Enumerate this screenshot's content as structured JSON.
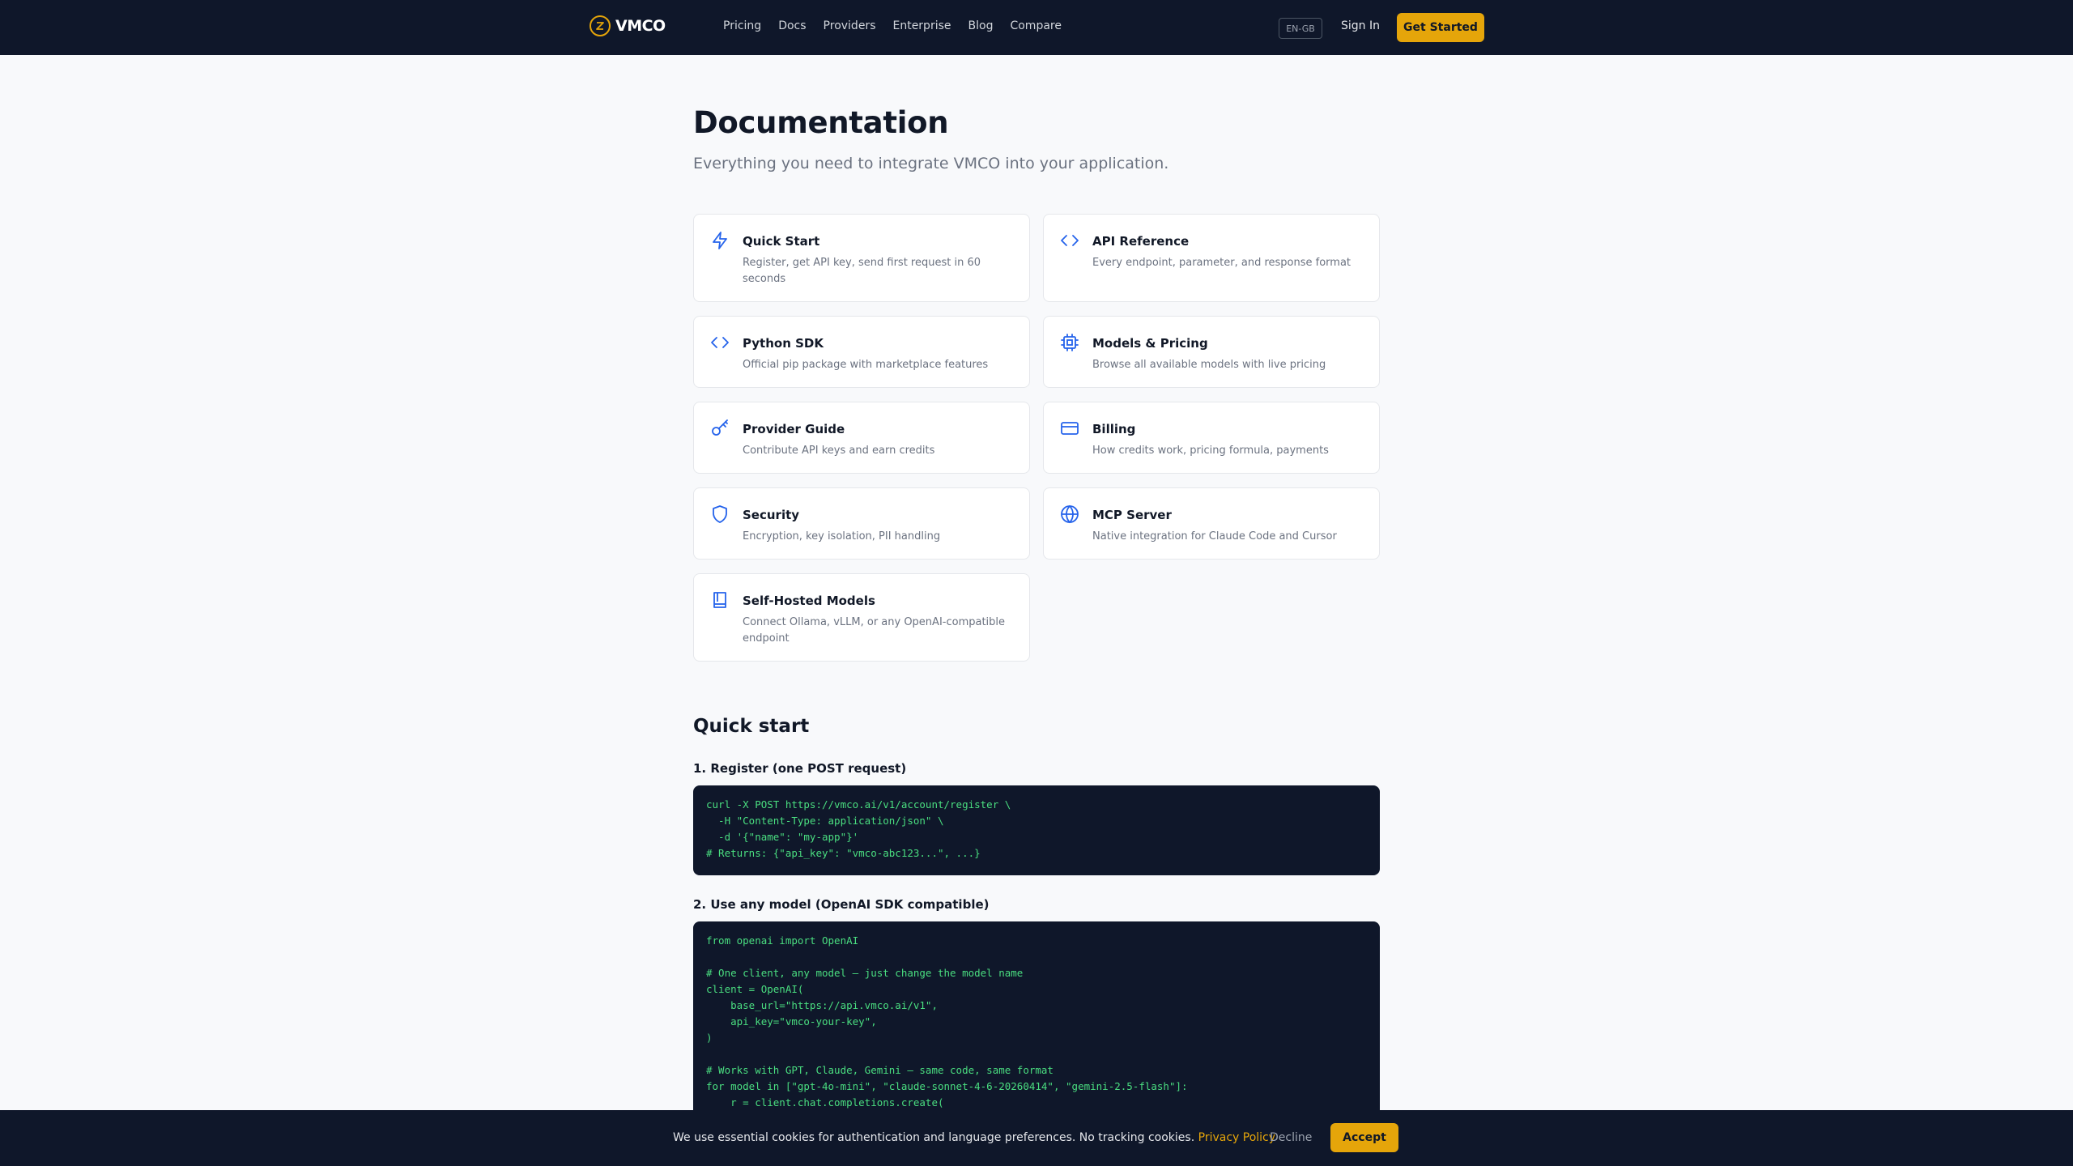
{
  "header": {
    "logo_text": "VMCO",
    "nav": [
      "Pricing",
      "Docs",
      "Providers",
      "Enterprise",
      "Blog",
      "Compare"
    ],
    "language": "EN-GB",
    "sign_in": "Sign In",
    "get_started": "Get Started"
  },
  "page": {
    "title": "Documentation",
    "subtitle": "Everything you need to integrate VMCO into your application."
  },
  "cards": [
    {
      "icon": "lightning-icon",
      "title": "Quick Start",
      "desc": "Register, get API key, send first request in 60 seconds"
    },
    {
      "icon": "code-icon",
      "title": "API Reference",
      "desc": "Every endpoint, parameter, and response format"
    },
    {
      "icon": "code-icon",
      "title": "Python SDK",
      "desc": "Official pip package with marketplace features"
    },
    {
      "icon": "cpu-icon",
      "title": "Models & Pricing",
      "desc": "Browse all available models with live pricing"
    },
    {
      "icon": "key-icon",
      "title": "Provider Guide",
      "desc": "Contribute API keys and earn credits"
    },
    {
      "icon": "credit-card-icon",
      "title": "Billing",
      "desc": "How credits work, pricing formula, payments"
    },
    {
      "icon": "shield-icon",
      "title": "Security",
      "desc": "Encryption, key isolation, PII handling"
    },
    {
      "icon": "globe-icon",
      "title": "MCP Server",
      "desc": "Native integration for Claude Code and Cursor"
    },
    {
      "icon": "book-icon",
      "title": "Self-Hosted Models",
      "desc": "Connect Ollama, vLLM, or any OpenAI-compatible endpoint"
    }
  ],
  "quickstart": {
    "title": "Quick start",
    "step1_title": "1. Register (one POST request)",
    "step1_code": "curl -X POST https://vmco.ai/v1/account/register \\\n  -H \"Content-Type: application/json\" \\\n  -d '{\"name\": \"my-app\"}'\n# Returns: {\"api_key\": \"vmco-abc123...\", ...}",
    "step2_title": "2. Use any model (OpenAI SDK compatible)",
    "step2_code": "from openai import OpenAI\n\n# One client, any model — just change the model name\nclient = OpenAI(\n    base_url=\"https://api.vmco.ai/v1\",\n    api_key=\"vmco-your-key\",\n)\n\n# Works with GPT, Claude, Gemini — same code, same format\nfor model in [\"gpt-4o-mini\", \"claude-sonnet-4-6-20260414\", \"gemini-2.5-flash\"]:\n    r = client.chat.completions.create("
  },
  "cookie": {
    "text": "We use essential cookies for authentication and language preferences. No tracking cookies.",
    "policy_link": "Privacy Policy",
    "decline": "Decline",
    "accept": "Accept"
  },
  "colors": {
    "accent": "#e5a50a",
    "header_bg": "#0f172a",
    "icon": "#2563eb",
    "code_text": "#4ade80"
  }
}
